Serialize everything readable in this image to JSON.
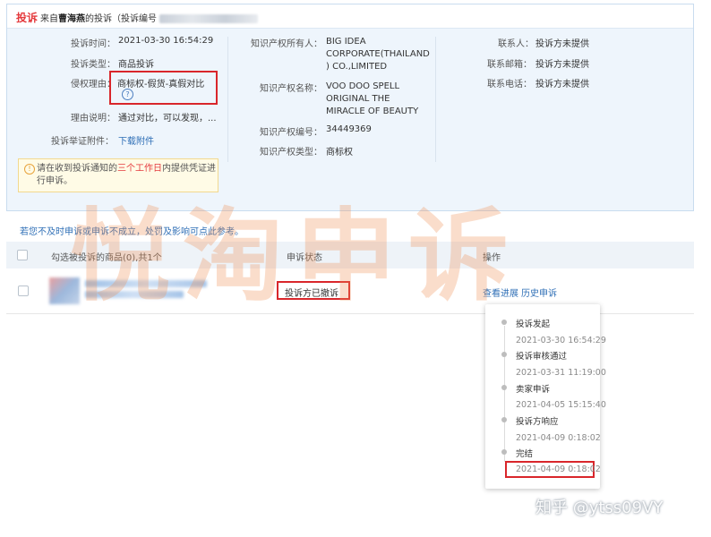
{
  "header": {
    "title": "投诉",
    "prefix": "来自",
    "complainant": "曹海燕",
    "suffix": "的投诉（投诉编号"
  },
  "details": {
    "col1": [
      {
        "label": "投诉时间：",
        "value": "2021-03-30 16:54:29"
      },
      {
        "label": "投诉类型：",
        "value": "商品投诉"
      },
      {
        "label": "侵权理由：",
        "value": "商标权-假货-真假对比"
      },
      {
        "label": "理由说明：",
        "value": "通过对比，可以发现，..."
      },
      {
        "label": "投诉举证附件：",
        "value": "下载附件"
      }
    ],
    "col2": [
      {
        "label": "知识产权所有人：",
        "value_lines": [
          "BIG IDEA",
          "CORPORATE(THAILAND",
          ") CO.,LIMITED"
        ]
      },
      {
        "label": "知识产权名称：",
        "value_lines": [
          "VOO DOO SPELL",
          "ORIGINAL THE",
          "MIRACLE OF BEAUTY"
        ]
      },
      {
        "label": "知识产权编号：",
        "value": "34449369"
      },
      {
        "label": "知识产权类型：",
        "value": "商标权"
      }
    ],
    "col3": [
      {
        "label": "联系人：",
        "value": "投诉方未提供"
      },
      {
        "label": "联系邮箱：",
        "value": "投诉方未提供"
      },
      {
        "label": "联系电话：",
        "value": "投诉方未提供"
      }
    ],
    "help_icon": "question-circle-icon"
  },
  "notice": {
    "icon": "warning-circle-icon",
    "text_before": "请在收到投诉通知的",
    "highlight": "三个工作日",
    "text_after": "内提供凭证进行申诉。"
  },
  "warning_line": "若您不及时申诉或申诉不成立，处罚及影响可点此参考。",
  "table": {
    "col_goods": "勾选被投诉的商品(0),共1个",
    "col_status": "申诉状态",
    "col_action": "操作",
    "row": {
      "status": "投诉方已撤诉",
      "action_progress": "查看进展",
      "action_history": "历史申诉"
    }
  },
  "timeline": [
    {
      "title": "投诉发起",
      "time": "2021-03-30 16:54:29"
    },
    {
      "title": "投诉审核通过",
      "time": "2021-03-31 11:19:00"
    },
    {
      "title": "卖家申诉",
      "time": "2021-04-05 15:15:40"
    },
    {
      "title": "投诉方响应",
      "time": "2021-04-09 0:18:02"
    },
    {
      "title": "完结",
      "time": "2021-04-09 0:18:02"
    }
  ],
  "watermark": "悦淘申诉",
  "corner_watermark": "知乎 @ytss09VY",
  "colors": {
    "accent_red": "#e4393c",
    "link_blue": "#2f6fb6",
    "panel_bg": "#eef5fc",
    "box_red": "#d9262b"
  }
}
